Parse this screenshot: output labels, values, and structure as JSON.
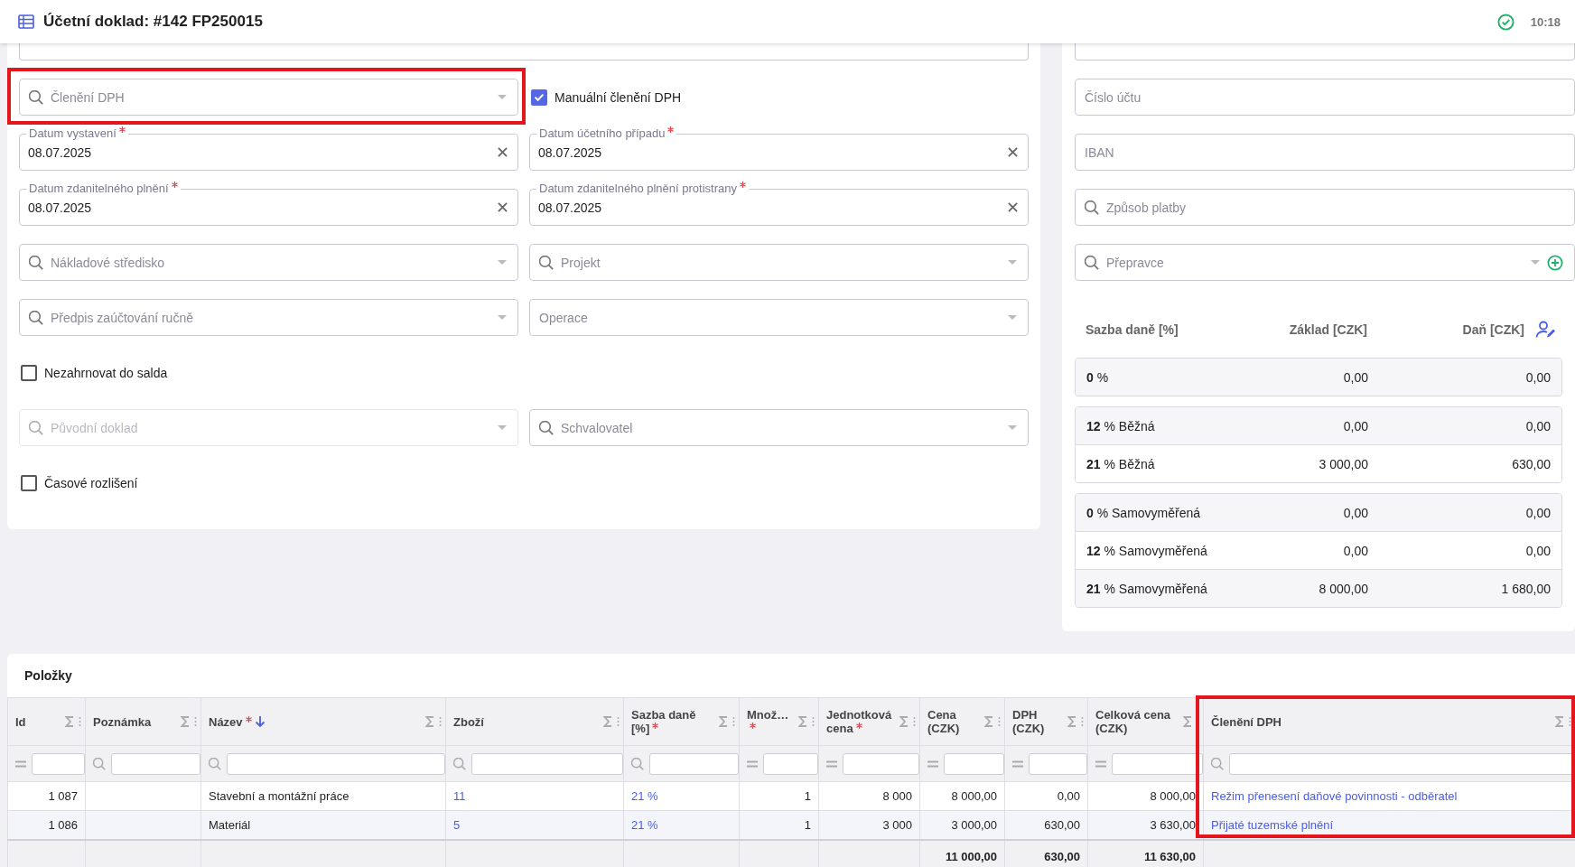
{
  "header": {
    "title": "Účetní doklad: #142 FP250015",
    "time": "10:18"
  },
  "form": {
    "rows": [
      [
        {
          "kind": "cut"
        }
      ],
      [
        {
          "kind": "lookup",
          "placeholder": "Členění DPH",
          "caret": true,
          "disabled": false,
          "highlighted": true
        },
        {
          "kind": "checkbox",
          "label": "Manuální členění DPH",
          "checked": true
        }
      ],
      [
        {
          "kind": "date",
          "label": "Datum vystavení",
          "value": "08.07.2025",
          "required": true
        },
        {
          "kind": "date",
          "label": "Datum účetního případu",
          "value": "08.07.2025",
          "required": true
        }
      ],
      [
        {
          "kind": "date",
          "label": "Datum zdanitelného plnění",
          "value": "08.07.2025",
          "required": true
        },
        {
          "kind": "date",
          "label": "Datum zdanitelného plnění protistrany",
          "value": "08.07.2025",
          "required": true
        }
      ],
      [
        {
          "kind": "lookup",
          "placeholder": "Nákladové středisko",
          "caret": true,
          "disabled": false
        },
        {
          "kind": "lookup",
          "placeholder": "Projekt",
          "caret": true,
          "disabled": false
        }
      ],
      [
        {
          "kind": "lookup",
          "placeholder": "Předpis zaúčtování ručně",
          "caret": true,
          "disabled": false
        },
        {
          "kind": "select",
          "placeholder": "Operace",
          "disabled": false
        }
      ],
      [
        {
          "kind": "checkbox",
          "label": "Nezahrnovat do salda",
          "checked": false
        }
      ],
      [
        {
          "kind": "lookup",
          "placeholder": "Původní doklad",
          "caret": true,
          "disabled": true
        },
        {
          "kind": "lookup",
          "placeholder": "Schvalovatel",
          "caret": true,
          "disabled": false
        }
      ],
      [
        {
          "kind": "checkbox",
          "label": "Časové rozlišení",
          "checked": false
        }
      ]
    ]
  },
  "payment": {
    "rows": [
      [
        {
          "kind": "cut"
        }
      ],
      [
        {
          "kind": "text",
          "placeholder": "Číslo účtu"
        }
      ],
      [
        {
          "kind": "text",
          "placeholder": "IBAN"
        }
      ],
      [
        {
          "kind": "lookup",
          "placeholder": "Způsob platby",
          "caret": false,
          "disabled": false
        }
      ],
      [
        {
          "kind": "lookup",
          "placeholder": "Přepravce",
          "caret": true,
          "addable": true,
          "disabled": false
        }
      ]
    ],
    "tax": {
      "columns": [
        "Sazba daně [%]",
        "Základ [CZK]",
        "Daň [CZK]"
      ],
      "groups": [
        [
          {
            "rate": "**0** %",
            "base": "0,00",
            "tax": "0,00"
          }
        ],
        [
          {
            "rate": "**12** % Běžná",
            "base": "0,00",
            "tax": "0,00"
          },
          {
            "rate": "**21** % Běžná",
            "base": "3 000,00",
            "tax": "630,00"
          }
        ],
        [
          {
            "rate": "**0** % Samovyměřená",
            "base": "0,00",
            "tax": "0,00"
          },
          {
            "rate": "**12** % Samovyměřená",
            "base": "0,00",
            "tax": "0,00"
          },
          {
            "rate": "**21** % Samovyměřená",
            "base": "8 000,00",
            "tax": "1 680,00"
          }
        ]
      ]
    }
  },
  "items": {
    "title": "Položky",
    "columns": [
      {
        "label": "Id",
        "kind": "number",
        "equals_filter": true,
        "required": false,
        "sorted": false
      },
      {
        "label": "Poznámka",
        "kind": "plain",
        "equals_filter": false,
        "required": false,
        "sorted": false
      },
      {
        "label": "Název",
        "kind": "plain",
        "equals_filter": false,
        "required": true,
        "sorted": true
      },
      {
        "label": "Zboží",
        "kind": "link",
        "equals_filter": false,
        "required": false,
        "sorted": false
      },
      {
        "label": "Sazba daně [%]",
        "kind": "link",
        "equals_filter": false,
        "required": true,
        "sorted": false
      },
      {
        "label": "Množ…",
        "kind": "number",
        "equals_filter": true,
        "required": true,
        "sorted": false
      },
      {
        "label": "Jednotková cena",
        "kind": "number",
        "equals_filter": true,
        "required": true,
        "sorted": false
      },
      {
        "label": "Cena (CZK)",
        "kind": "number",
        "equals_filter": true,
        "required": false,
        "sorted": false,
        "total": "11 000,00"
      },
      {
        "label": "DPH (CZK)",
        "kind": "number",
        "equals_filter": true,
        "required": false,
        "sorted": false,
        "total": "630,00"
      },
      {
        "label": "Celková cena (CZK)",
        "kind": "number",
        "equals_filter": true,
        "required": false,
        "sorted": false,
        "total": "11 630,00"
      },
      {
        "label": "Členění DPH",
        "kind": "link",
        "equals_filter": false,
        "required": false,
        "sorted": false,
        "highlighted": true
      }
    ],
    "rows": [
      [
        "1 087",
        null,
        "Stavební a montážní práce",
        "11",
        "21 %",
        "1",
        "8 000",
        "8 000,00",
        "0,00",
        "8 000,00",
        "Režim přenesení daňové povinnosti - odběratel"
      ],
      [
        "1 086",
        null,
        "Materiál",
        "5",
        "21 %",
        "1",
        "3 000",
        "3 000,00",
        "630,00",
        "3 630,00",
        "Přijaté tuzemské plnění"
      ]
    ]
  }
}
